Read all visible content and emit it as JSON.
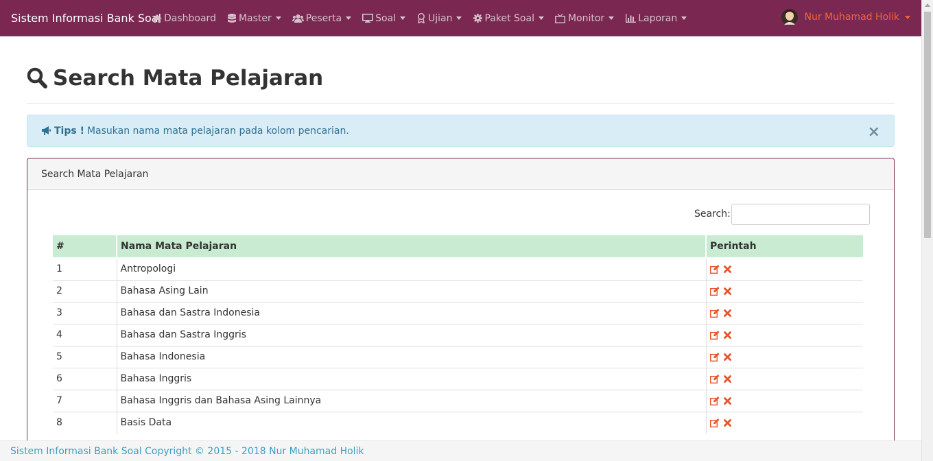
{
  "app": {
    "brand": "Sistem Informasi Bank Soal"
  },
  "nav": {
    "items": [
      {
        "label": "Dashboard",
        "icon": "home-icon",
        "dropdown": false
      },
      {
        "label": "Master",
        "icon": "database-icon",
        "dropdown": true
      },
      {
        "label": "Peserta",
        "icon": "users-icon",
        "dropdown": true
      },
      {
        "label": "Soal",
        "icon": "desktop-icon",
        "dropdown": true
      },
      {
        "label": "Ujian",
        "icon": "award-icon",
        "dropdown": true
      },
      {
        "label": "Paket Soal",
        "icon": "gear-icon",
        "dropdown": true
      },
      {
        "label": "Monitor",
        "icon": "tv-icon",
        "dropdown": true
      },
      {
        "label": "Laporan",
        "icon": "bar-chart-icon",
        "dropdown": true
      }
    ],
    "user": "Nur Muhamad Holik"
  },
  "page": {
    "title": "Search Mata Pelajaran"
  },
  "alert": {
    "strong": "Tips !",
    "text": "Masukan nama mata pelajaran pada kolom pencarian.",
    "close": "×"
  },
  "panel": {
    "heading": "Search Mata Pelajaran",
    "search_label": "Search:",
    "search_value": ""
  },
  "table": {
    "headers": [
      "#",
      "Nama Mata Pelajaran",
      "Perintah"
    ],
    "rows": [
      {
        "no": "1",
        "name": "Antropologi"
      },
      {
        "no": "2",
        "name": "Bahasa Asing Lain"
      },
      {
        "no": "3",
        "name": "Bahasa dan Sastra Indonesia"
      },
      {
        "no": "4",
        "name": "Bahasa dan Sastra Inggris"
      },
      {
        "no": "5",
        "name": "Bahasa Indonesia"
      },
      {
        "no": "6",
        "name": "Bahasa Inggris"
      },
      {
        "no": "7",
        "name": "Bahasa Inggris dan Bahasa Asing Lainnya"
      },
      {
        "no": "8",
        "name": "Basis Data"
      }
    ]
  },
  "footer": {
    "text": "Sistem Informasi Bank Soal Copyright © 2015 - 2018 Nur Muhamad Holik"
  },
  "colors": {
    "navbar": "#7a2851",
    "user": "#f0643c",
    "header_row": "#c9ebd2",
    "alert_bg": "#d9edf7",
    "action": "#e8532a"
  }
}
